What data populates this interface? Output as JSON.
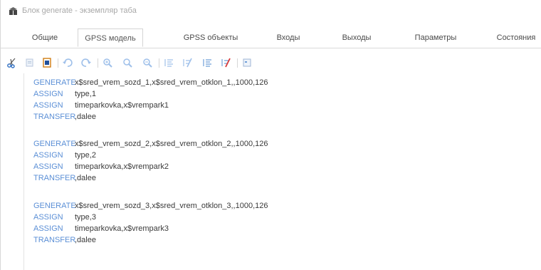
{
  "window": {
    "title": "Блок generate - экземпляр табa"
  },
  "tabs": [
    {
      "label": "Общие",
      "active": false
    },
    {
      "label": "GPSS модель",
      "active": true
    },
    {
      "label": "GPSS объекты",
      "active": false
    },
    {
      "label": "Входы",
      "active": false
    },
    {
      "label": "Выходы",
      "active": false
    },
    {
      "label": "Параметры",
      "active": false
    },
    {
      "label": "Состояния",
      "active": false
    }
  ],
  "toolbar": {
    "icons": [
      "cut-icon",
      "copy-icon",
      "paste-icon",
      "undo-icon",
      "redo-icon",
      "zoom-in-icon",
      "zoom-icon",
      "zoom-out-icon",
      "outdent-icon",
      "clear-outdent-icon",
      "indent-icon",
      "clear-indent-icon",
      "block-icon"
    ]
  },
  "editor": {
    "lines": [
      {
        "keyword": "GENERATE",
        "args": "x$sred_vrem_sozd_1,x$sred_vrem_otklon_1,,1000,126"
      },
      {
        "keyword": "ASSIGN",
        "args": "type,1"
      },
      {
        "keyword": "ASSIGN",
        "args": "timeparkovka,x$vrempark1"
      },
      {
        "keyword": "TRANSFER",
        "args": ",dalee"
      },
      {
        "keyword": "GENERATE",
        "args": "x$sred_vrem_sozd_2,x$sred_vrem_otklon_2,,1000,126"
      },
      {
        "keyword": "ASSIGN",
        "args": "type,2"
      },
      {
        "keyword": "ASSIGN",
        "args": "timeparkovka,x$vrempark2"
      },
      {
        "keyword": "TRANSFER",
        "args": ",dalee"
      },
      {
        "keyword": "GENERATE",
        "args": "x$sred_vrem_sozd_3,x$sred_vrem_otklon_3,,1000,126"
      },
      {
        "keyword": "ASSIGN",
        "args": "type,3"
      },
      {
        "keyword": "ASSIGN",
        "args": "timeparkovka,x$vrempark3"
      },
      {
        "keyword": "TRANSFER",
        "args": ",dalee"
      }
    ]
  },
  "colors": {
    "keyword": "#5b8fd6",
    "text": "#3a3a3a",
    "toolbar_icon": "#8fb5e6"
  }
}
